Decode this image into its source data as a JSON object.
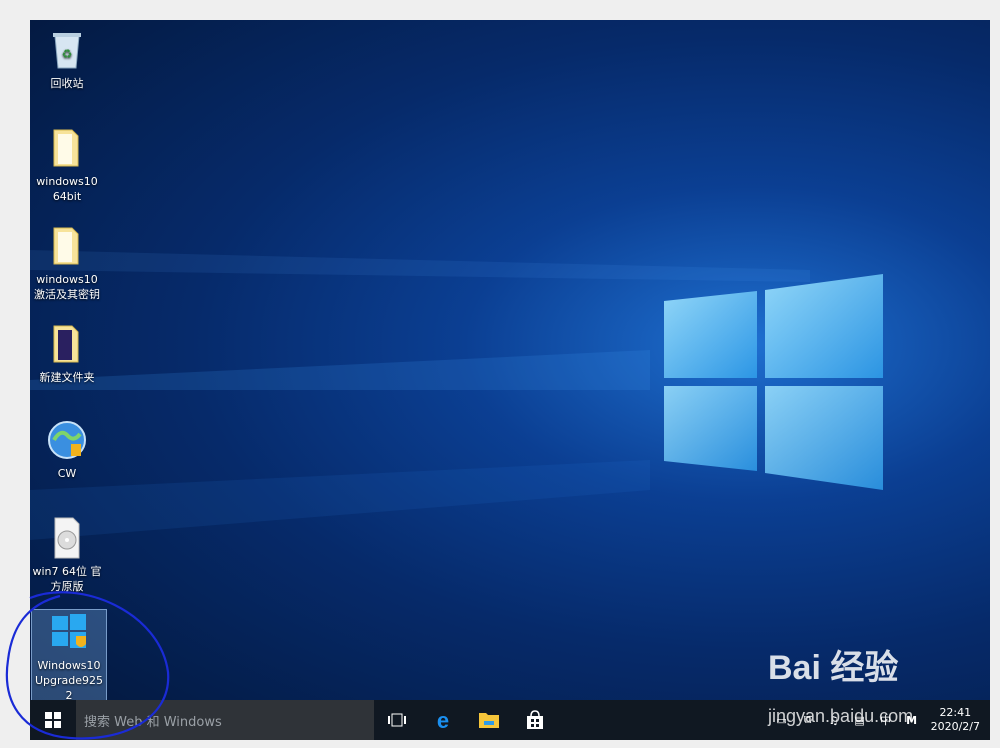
{
  "desktop": {
    "icons": [
      {
        "label": "回收站"
      },
      {
        "label": "windows10\n64bit"
      },
      {
        "label": "windows10\n激活及其密钥"
      },
      {
        "label": "新建文件夹"
      },
      {
        "label": "CW"
      },
      {
        "label": "win7 64位 官\n方原版"
      },
      {
        "label": "Windows10\nUpgrade925\n2"
      }
    ]
  },
  "taskbar": {
    "search_placeholder": "搜索 Web 和 Windows",
    "apps": [
      "task-view-icon",
      "edge-icon",
      "file-explorer-icon",
      "store-icon"
    ],
    "tray": {
      "input_lang": "中",
      "ime_mode": "M",
      "time": "22:41",
      "date": "2020/2/7"
    }
  },
  "watermark": {
    "brand": "Bai 经验",
    "url": "jingyan.baidu.com"
  },
  "colors": {
    "taskbar": "#101822",
    "search": "#2f3338",
    "annotation_circle": "#1a2bd6"
  }
}
